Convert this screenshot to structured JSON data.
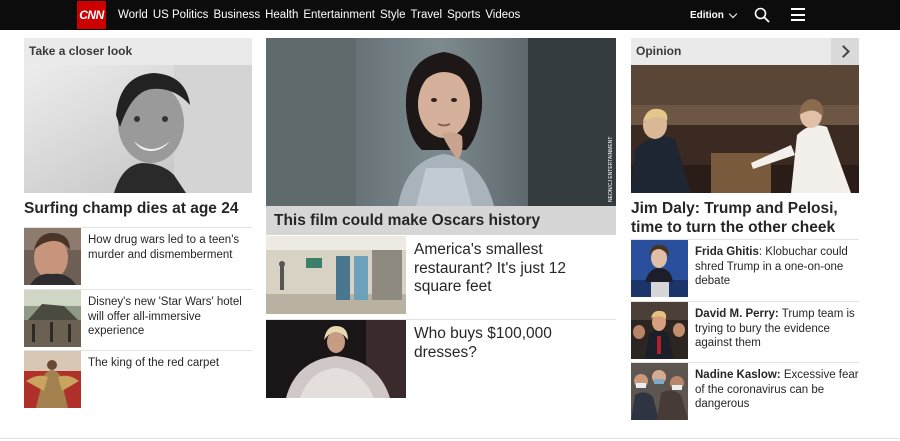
{
  "nav": {
    "logo": "CNN",
    "links": [
      "World",
      "US Politics",
      "Business",
      "Health",
      "Entertainment",
      "Style",
      "Travel",
      "Sports",
      "Videos"
    ],
    "edition_label": "Edition"
  },
  "left": {
    "section_title": "Take a closer look",
    "headline": "Surfing champ dies at age 24",
    "items": [
      {
        "text": "How drug wars led to a teen's murder and dismemberment"
      },
      {
        "text": "Disney's new 'Star Wars' hotel will offer all-immersive experience"
      },
      {
        "text": "The king of the red carpet"
      }
    ]
  },
  "middle": {
    "photo_credit": "NEON/CJ ENTERTAINMENT",
    "headline": "This film could make Oscars history",
    "items": [
      {
        "text": "America's smallest restaurant? It's just 12 square feet"
      },
      {
        "text": "Who buys $100,000 dresses?"
      }
    ]
  },
  "right": {
    "section_title": "Opinion",
    "headline": "Jim Daly: Trump and Pelosi, time to turn the other cheek",
    "items": [
      {
        "author": "Frida Ghitis",
        "text": ": Klobuchar could shred Trump in a one-on-one debate"
      },
      {
        "author": "David M. Perry:",
        "text": " Trump team is trying to bury the evidence against them"
      },
      {
        "author": "Nadine Kaslow:",
        "text": " Excessive fear of the coronavirus can be dangerous"
      }
    ]
  }
}
